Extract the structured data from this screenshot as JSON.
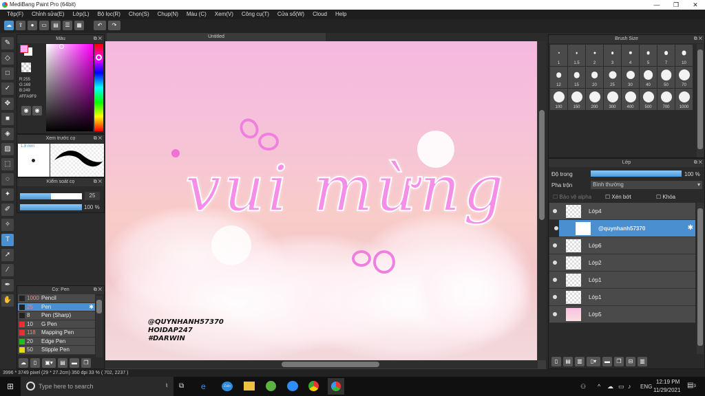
{
  "window": {
    "title": "MediBang Paint Pro (64bit)",
    "minimize": "—",
    "maximize": "❐",
    "close": "✕"
  },
  "menu": [
    "Tệp(F)",
    "Chỉnh sửa(E)",
    "Lớp(L)",
    "Bộ lọc(R)",
    "Chọn(S)",
    "Chụp(N)",
    "Màu (C)",
    "Xem(V)",
    "Công cụ(T)",
    "Cửa sổ(W)",
    "Cloud",
    "Help"
  ],
  "toolbar": {
    "icons": [
      "cloud-icon",
      "share-icon",
      "comment-icon",
      "monitor-icon",
      "page-icon",
      "panel-icon",
      "grid-icon"
    ],
    "undo": "↶",
    "redo": "↷"
  },
  "tools": [
    "brush-icon",
    "eraser-icon",
    "rectangle-icon",
    "check-icon",
    "move-icon",
    "fill-rect-icon",
    "bucket-icon",
    "gradient-icon",
    "select-rect-icon",
    "lasso-icon",
    "magic-wand-icon",
    "select-pen-icon",
    "select-eraser-icon",
    "text-icon",
    "operation-icon",
    "eyedropper-icon",
    "pen-icon",
    "hand-icon"
  ],
  "color_panel": {
    "title": "Màu",
    "r": "R:255",
    "g": "G:169",
    "b": "B:249",
    "hex": "#FFA9F9",
    "fg": "#FFA9F9",
    "bg": "#FFFFFF"
  },
  "brush_preview": {
    "title": "Xem trước cọ",
    "size": "1.8 mm"
  },
  "brush_control": {
    "title": "Kiểm soát cọ",
    "size_value": "25",
    "opacity_value": "100 %",
    "size_fraction": 0.5,
    "opacity_fraction": 1.0
  },
  "brush_list": {
    "title": "Cọ: Pen",
    "items": [
      {
        "size": "1000",
        "name": "Pencil",
        "color": "#222222"
      },
      {
        "size": "25",
        "name": "Pen",
        "color": "#222222",
        "selected": true
      },
      {
        "size": "8",
        "name": "Pen (Sharp)",
        "color": "#222222"
      },
      {
        "size": "10",
        "name": "G Pen",
        "color": "#e83030"
      },
      {
        "size": "118",
        "name": "Mapping Pen",
        "color": "#e83030"
      },
      {
        "size": "20",
        "name": "Edge Pen",
        "color": "#22bb22"
      },
      {
        "size": "50",
        "name": "Stipple Pen",
        "color": "#e8d820"
      }
    ]
  },
  "canvas": {
    "tab": "Untitled",
    "text": "vui mừng",
    "watermark": [
      "@QUYNHANH57370",
      "HOIDAP247",
      "#DARWIN"
    ]
  },
  "brush_size": {
    "title": "Brush Size",
    "sizes": [
      "1",
      "1.5",
      "2",
      "3",
      "4",
      "5",
      "7",
      "10",
      "12",
      "15",
      "20",
      "25",
      "30",
      "40",
      "50",
      "70",
      "100",
      "150",
      "200",
      "300",
      "400",
      "500",
      "700",
      "1000"
    ]
  },
  "layer_panel": {
    "title": "Lớp",
    "opacity_label": "Độ trong",
    "opacity_value": "100 %",
    "opacity_fraction": 1.0,
    "blend_label": "Pha trộn",
    "blend_value": "Bình thường",
    "protect_alpha": "Bảo vệ alpha",
    "clipping": "Xén bớt",
    "lock": "Khóa",
    "layers": [
      {
        "name": "Lớp4"
      },
      {
        "name": "@quynhanh57370",
        "selected": true
      },
      {
        "name": "Lớp6"
      },
      {
        "name": "Lớp2"
      },
      {
        "name": "Lớp1"
      },
      {
        "name": "Lớp1"
      },
      {
        "name": "Lớp5"
      }
    ]
  },
  "status": {
    "text": "3996 * 3749 pixel   (29 * 27.2cm)   350 dpi   33 %   ( 702, 2237 )"
  },
  "taskbar": {
    "search_placeholder": "Type here to search",
    "time": "12:19 PM",
    "date": "11/29/2021",
    "lang": "ENG",
    "notifications": "3"
  }
}
